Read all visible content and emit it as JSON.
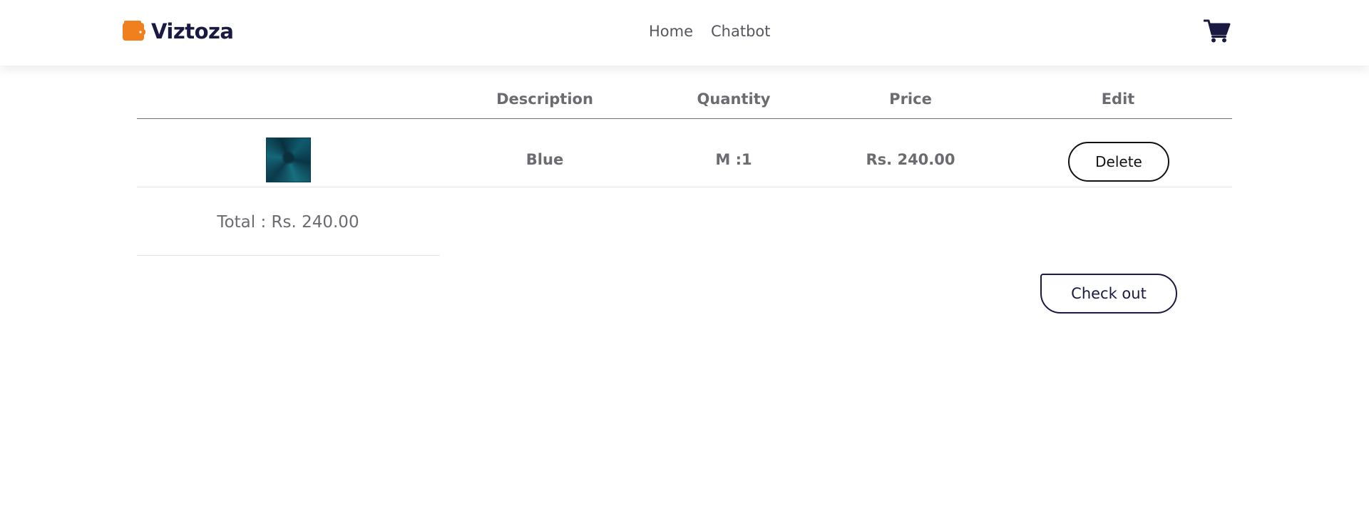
{
  "brand": {
    "name": "Viztoza",
    "icon": "wallet-icon",
    "icon_color": "#f0801e",
    "name_color": "#1a1942"
  },
  "nav": {
    "links": [
      {
        "label": "Home"
      },
      {
        "label": "Chatbot"
      }
    ],
    "cart_icon": "shopping-cart-icon"
  },
  "cart": {
    "columns": [
      "",
      "Description",
      "Quantity",
      "Price",
      "Edit"
    ],
    "items": [
      {
        "image": "blue-fabric-thumbnail",
        "description": "Blue",
        "quantity": "M :1",
        "price": "Rs. 240.00",
        "action_label": "Delete"
      }
    ],
    "total_label": "Total : Rs. 240.00",
    "checkout_label": "Check out"
  },
  "colors": {
    "text_muted": "#6b6b70",
    "accent_dark": "#1a1942",
    "accent_orange": "#f0801e"
  }
}
